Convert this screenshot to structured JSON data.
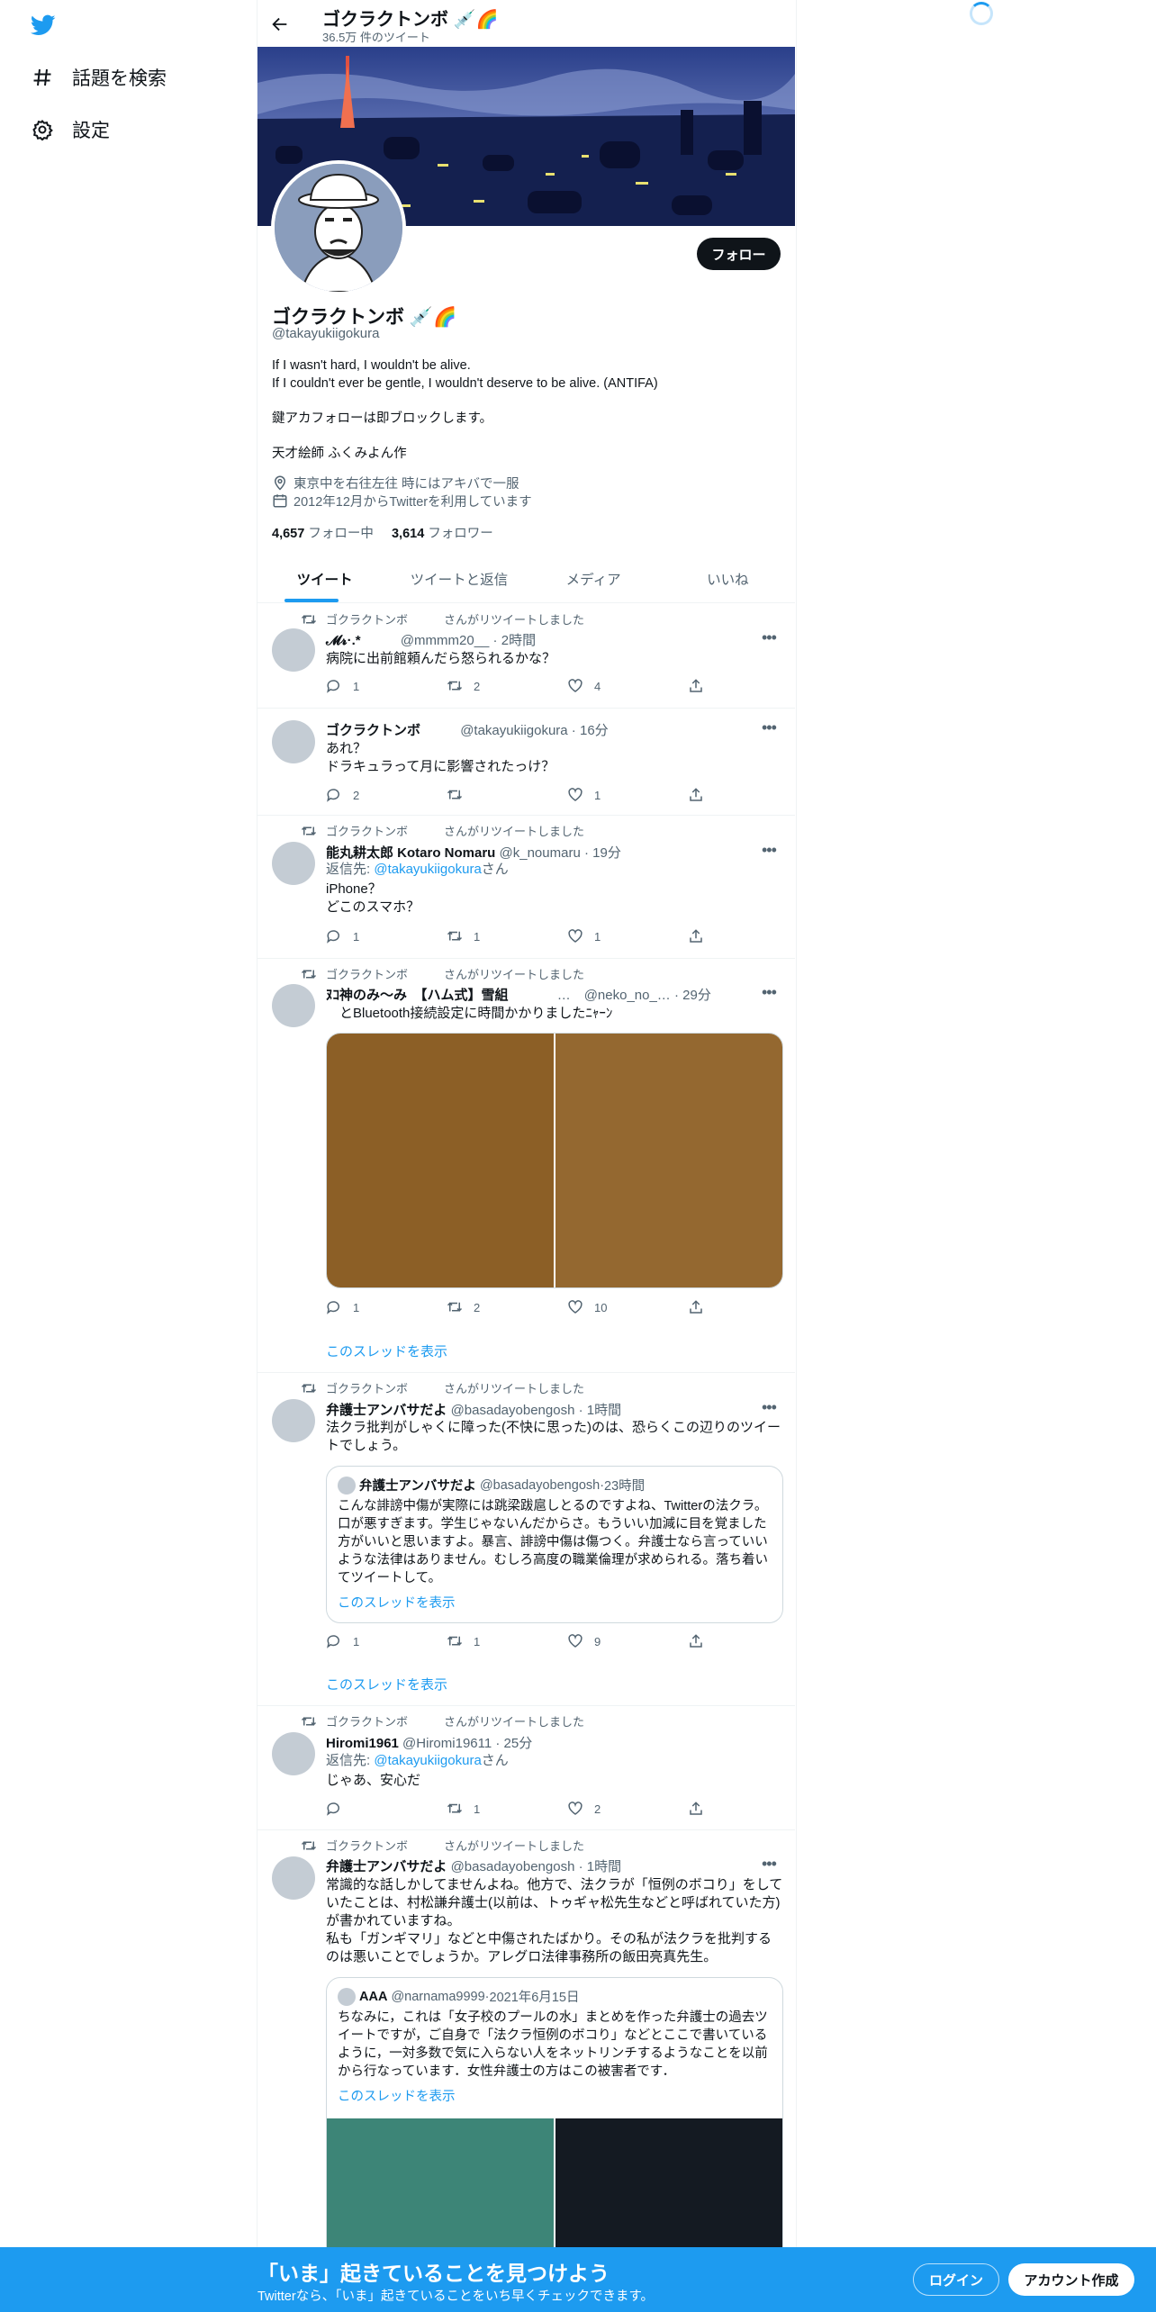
{
  "nav": {
    "explore_label": "話題を検索",
    "settings_label": "設定"
  },
  "header": {
    "name": "ゴクラクトンボ 💉🌈",
    "tweet_count": "36.5万 件のツイート"
  },
  "profile": {
    "follow_label": "フォロー",
    "name": "ゴクラクトンボ 💉🌈",
    "handle": "@takayukiigokura",
    "bio": "If I wasn't hard, I wouldn't be alive.\nIf I couldn't ever be gentle, I wouldn't deserve to be alive. (ANTIFA)\n\n鍵アカフォローは即ブロックします。\n\n天才絵師 ふくみよん作",
    "location": "東京中を右往左往 時にはアキバで一服",
    "joined": "2012年12月からTwitterを利用しています",
    "following_count": "4,657",
    "following_label": "フォロー中",
    "followers_count": "3,614",
    "followers_label": "フォロワー"
  },
  "tabs": [
    "ツイート",
    "ツイートと返信",
    "メディア",
    "いいね"
  ],
  "retweet_label": {
    "who": "ゴクラクトンボ",
    "suffix": "さんがリツイートしました"
  },
  "tweets": [
    {
      "name": "𝓜𝓻·.*",
      "handle": "@mmmm20__",
      "time": "2時間",
      "text": "病院に出前館頼んだら怒られるかな？",
      "reply": "1",
      "retweet": "2",
      "like": "4"
    },
    {
      "name": "ゴクラクトンボ",
      "handle": "@takayukiigokura",
      "time": "16分",
      "text": "あれ？\nドラキュラって月に影響されたっけ？",
      "reply": "2",
      "retweet": "",
      "like": "1"
    },
    {
      "name": "能丸耕太郎 Kotaro Nomaru",
      "handle": "@k_noumaru",
      "time": "19分",
      "reply_to_prefix": "返信先: ",
      "reply_to_handle": "@takayukiigokura",
      "reply_to_suffix": "さん",
      "text": "iPhone？\nどこのスマホ？",
      "reply": "1",
      "retweet": "1",
      "like": "1"
    },
    {
      "name": "ﾇｺ神のみ～み　【ハム式】雪組",
      "handle": "…　@neko_no_…",
      "time": "29分",
      "text": "　とBluetooth接続設定に時間かかりましたﾆｬｰﾝ",
      "reply": "1",
      "retweet": "2",
      "like": "10",
      "thread": "このスレッドを表示"
    },
    {
      "name": "弁護士アンバサだよ",
      "handle": "@basadayobengosh",
      "time": "1時間",
      "text": "法クラ批判がしゃくに障った(不快に思った)のは、恐らくこの辺りのツイートでしょう。",
      "quote": {
        "name": "弁護士アンバサだよ",
        "handle": "@basadayobengosh",
        "time": "23時間",
        "text": "こんな誹謗中傷が実際には跳梁跋扈しとるのですよね、Twitterの法クラ。口が悪すぎます。学生じゃないんだからさ。もういい加減に目を覚ました方がいいと思いますよ。暴言、誹謗中傷は傷つく。弁護士なら言っていいような法律はありません。むしろ高度の職業倫理が求められる。落ち着いてツイートして。",
        "thread": "このスレッドを表示"
      },
      "reply": "1",
      "retweet": "1",
      "like": "9",
      "thread": "このスレッドを表示"
    },
    {
      "name": "Hiromi1961",
      "handle": "@Hiromi19611",
      "time": "25分",
      "reply_to_prefix": "返信先: ",
      "reply_to_handle": "@takayukiigokura",
      "reply_to_suffix": "さん",
      "text": "じゃあ、安心だ",
      "reply": "",
      "retweet": "1",
      "like": "2"
    },
    {
      "name": "弁護士アンバサだよ",
      "handle": "@basadayobengosh",
      "time": "1時間",
      "text": "常識的な話しかしてませんよね。他方で、法クラが「恒例のボコり」をしていたことは、村松謙弁護士(以前は、トゥギャ松先生などと呼ばれていた方)が書かれていますね。\n私も「ガンギマリ」などと中傷されたばかり。その私が法クラを批判するのは悪いことでしょうか。アレグロ法律事務所の飯田亮真先生。",
      "quote": {
        "name": "AAA",
        "handle": "@narnama9999",
        "time": "2021年6月15日",
        "text": "ちなみに，これは「女子校のプールの水」まとめを作った弁護士の過去ツイートですが，ご自身で「法クラ恒例のボコり」などとここで書いているように，一対多数で気に入らない人をネットリンチするようなことを以前から行なっています．女性弁護士の方はこの被害者です．",
        "thread": "このスレッドを表示"
      }
    }
  ],
  "bottom_bar": {
    "title": "「いま」起きていることを見つけよう",
    "subtitle": "Twitterなら、「いま」起きていることをいち早くチェックできます。",
    "login_label": "ログイン",
    "signup_label": "アカウント作成"
  },
  "colors": {
    "accent": "#1d9bf0",
    "text": "#0f1419",
    "secondary": "#536471",
    "media_left": "#8c5f26",
    "media_right": "#946830",
    "media2_left": "#3d8577",
    "media2_right": "#141a22"
  }
}
